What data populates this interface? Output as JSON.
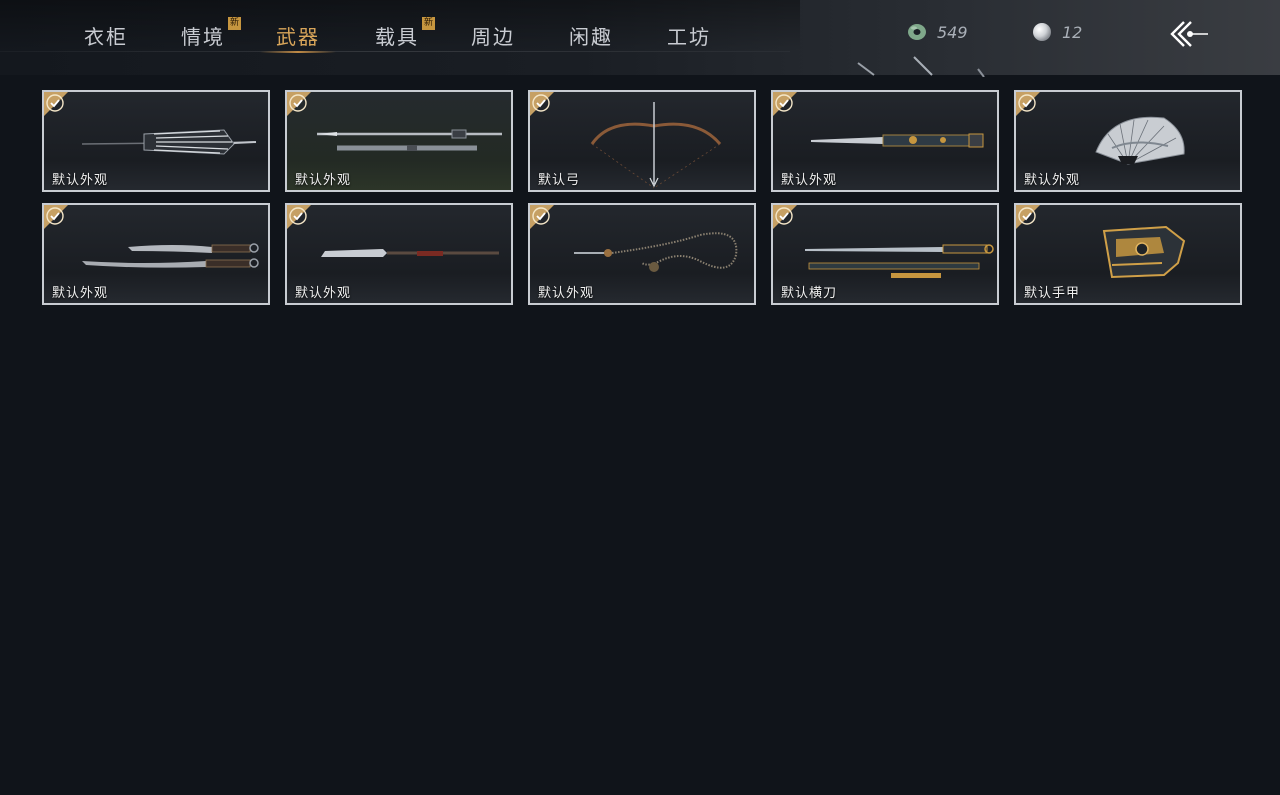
{
  "nav": {
    "tabs": [
      {
        "label": "衣柜",
        "new": false
      },
      {
        "label": "情境",
        "new": true
      },
      {
        "label": "武器",
        "new": false,
        "active": true
      },
      {
        "label": "载具",
        "new": true
      },
      {
        "label": "周边",
        "new": false
      },
      {
        "label": "闲趣",
        "new": false
      },
      {
        "label": "工坊",
        "new": false
      }
    ],
    "new_badge": "新"
  },
  "currency": {
    "jade": {
      "icon": "jade-coin-icon",
      "value": "549"
    },
    "pearl": {
      "icon": "pearl-icon",
      "value": "12"
    }
  },
  "back_icon": "back-arrow-icon",
  "colors": {
    "accent": "#d8a55a",
    "check": "#c6a064",
    "background": "#10141a",
    "card_border": "#c8ccd2"
  },
  "items": [
    {
      "label": "默认外观",
      "icon": "umbrella-icon",
      "equipped": true
    },
    {
      "label": "默认外观",
      "icon": "twin-spear-icon",
      "equipped": true
    },
    {
      "label": "默认弓",
      "icon": "bow-icon",
      "equipped": true
    },
    {
      "label": "默认外观",
      "icon": "ornate-blade-icon",
      "equipped": true
    },
    {
      "label": "默认外观",
      "icon": "folding-fan-icon",
      "equipped": true
    },
    {
      "label": "默认外观",
      "icon": "dual-sabres-icon",
      "equipped": true
    },
    {
      "label": "默认外观",
      "icon": "glaive-icon",
      "equipped": true
    },
    {
      "label": "默认外观",
      "icon": "rope-dart-icon",
      "equipped": true
    },
    {
      "label": "默认横刀",
      "icon": "hengdao-icon",
      "equipped": true
    },
    {
      "label": "默认手甲",
      "icon": "gauntlet-icon",
      "equipped": true
    }
  ]
}
